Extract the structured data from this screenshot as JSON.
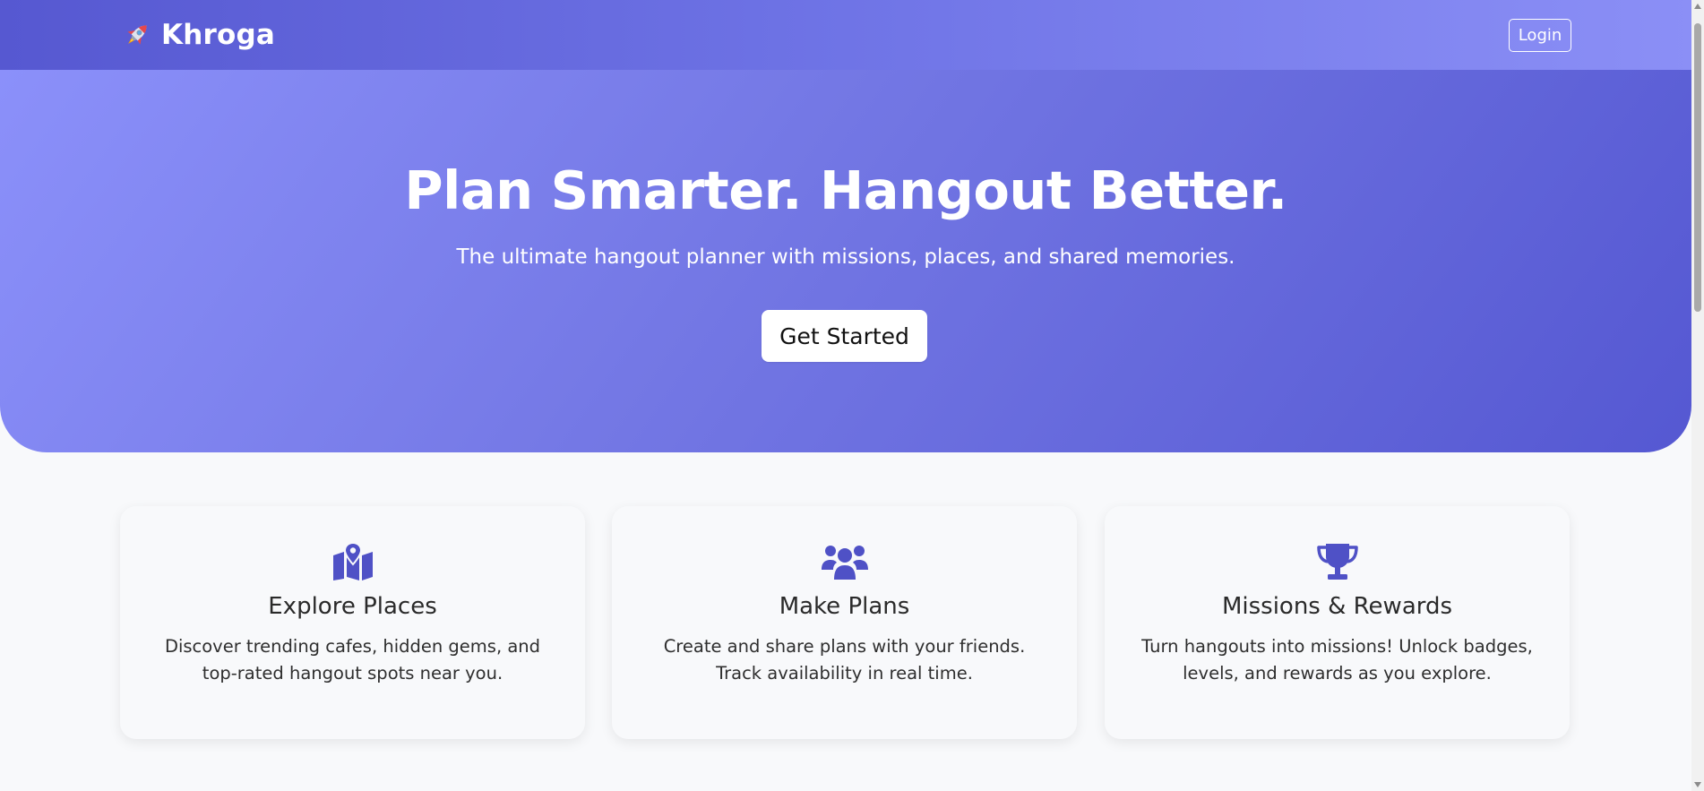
{
  "nav": {
    "brand": "Khroga",
    "brand_icon": "rocket-icon",
    "login_label": "Login"
  },
  "hero": {
    "title": "Plan Smarter. Hangout Better.",
    "subtitle": "The ultimate hangout planner with missions, places, and shared memories.",
    "cta_label": "Get Started"
  },
  "features": [
    {
      "icon": "map-location-icon",
      "title": "Explore Places",
      "desc": "Discover trending cafes, hidden gems, and top-rated hangout spots near you."
    },
    {
      "icon": "users-icon",
      "title": "Make Plans",
      "desc": "Create and share plans with your friends. Track availability in real time."
    },
    {
      "icon": "trophy-icon",
      "title": "Missions & Rewards",
      "desc": "Turn hangouts into missions! Unlock badges, levels, and rewards as you explore."
    }
  ],
  "colors": {
    "accent": "#5558d2",
    "accent_light": "#8b90fa",
    "icon": "#4f51c6",
    "background": "#f8f9fb"
  }
}
